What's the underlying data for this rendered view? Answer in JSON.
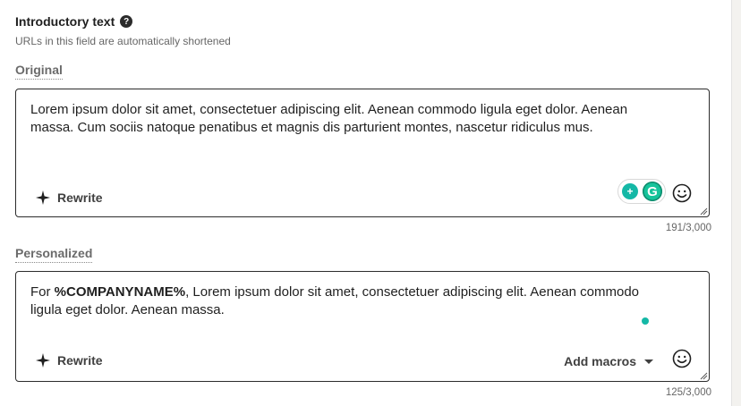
{
  "section": {
    "title": "Introductory text",
    "help_icon": "question-circle-icon",
    "hint": "URLs in this field are automatically shortened"
  },
  "original": {
    "label": "Original",
    "text": "Lorem ipsum dolor sit amet, consectetuer adipiscing elit. Aenean commodo ligula eget dolor. Aenean massa. Cum sociis natoque penatibus et magnis dis parturient montes, nascetur ridiculus mus.",
    "rewrite_label": "Rewrite",
    "counter": "191/3,000",
    "grammarly_bulb": "+",
    "grammarly_logo": "G"
  },
  "personalized": {
    "label": "Personalized",
    "text_prefix": "For ",
    "macro": "%COMPANYNAME%",
    "text_rest": ", Lorem ipsum dolor sit amet, consectetuer adipiscing elit. Aenean commodo ligula eget dolor. Aenean massa.",
    "rewrite_label": "Rewrite",
    "add_macros_label": "Add macros",
    "counter": "125/3,000"
  },
  "colors": {
    "accent_teal": "#14b8a6",
    "grammarly_green": "#15c39a",
    "border": "#2c2c2c"
  }
}
